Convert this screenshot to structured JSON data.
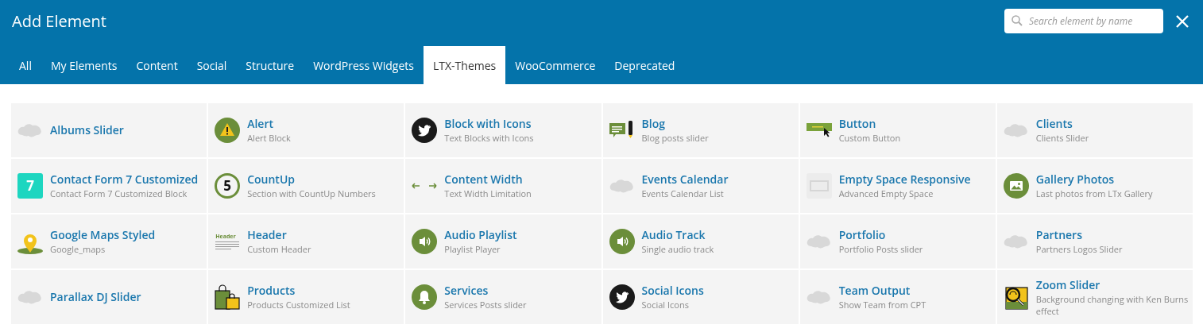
{
  "window": {
    "title": "Add Element"
  },
  "search": {
    "placeholder": "Search element by name"
  },
  "tabs": [
    {
      "label": "All",
      "selected": false
    },
    {
      "label": "My Elements",
      "selected": false
    },
    {
      "label": "Content",
      "selected": false
    },
    {
      "label": "Social",
      "selected": false
    },
    {
      "label": "Structure",
      "selected": false
    },
    {
      "label": "WordPress Widgets",
      "selected": false
    },
    {
      "label": "LTX-Themes",
      "selected": true
    },
    {
      "label": "WooCommerce",
      "selected": false
    },
    {
      "label": "Deprecated",
      "selected": false
    }
  ],
  "elements": [
    {
      "name": "Albums Slider",
      "kind": "cloud"
    },
    {
      "name": "Alert",
      "description": "Alert Block",
      "kind": "alert"
    },
    {
      "name": "Block with Icons",
      "description": "Text Blocks with Icons",
      "kind": "bird"
    },
    {
      "name": "Blog",
      "description": "Blog posts slider",
      "kind": "blog"
    },
    {
      "name": "Button",
      "description": "Custom Button",
      "kind": "button"
    },
    {
      "name": "Clients",
      "description": "Clients Slider",
      "kind": "cloud"
    },
    {
      "name": "Contact Form 7 Customized",
      "description": "Contact Form 7 Customized Block",
      "kind": "square",
      "badge": "7"
    },
    {
      "name": "CountUp",
      "description": "Section with CountUp Numbers",
      "kind": "ring",
      "badge": "5"
    },
    {
      "name": "Content Width",
      "description": "Text Width Limitation",
      "kind": "arrows"
    },
    {
      "name": "Events Calendar",
      "description": "Events Calendar List",
      "kind": "cloud"
    },
    {
      "name": "Empty Space Responsive",
      "description": "Advanced Empty Space",
      "kind": "empty"
    },
    {
      "name": "Gallery Photos",
      "description": "Last photos from LTx Gallery",
      "kind": "gallery"
    },
    {
      "name": "Google Maps Styled",
      "description": "Google_maps",
      "kind": "pin"
    },
    {
      "name": "Header",
      "description": "Custom Header",
      "kind": "header",
      "badge": "Header"
    },
    {
      "name": "Audio Playlist",
      "description": "Playlist Player",
      "kind": "audio"
    },
    {
      "name": "Audio Track",
      "description": "Single audio track",
      "kind": "audio"
    },
    {
      "name": "Portfolio",
      "description": "Portfolio Posts slider",
      "kind": "cloud"
    },
    {
      "name": "Partners",
      "description": "Partners Logos Slider",
      "kind": "cloud"
    },
    {
      "name": "Parallax DJ Slider",
      "kind": "cloud"
    },
    {
      "name": "Products",
      "description": "Products Customized List",
      "kind": "bags"
    },
    {
      "name": "Services",
      "description": "Services Posts slider",
      "kind": "bell"
    },
    {
      "name": "Social Icons",
      "description": "Social Icons",
      "kind": "bird"
    },
    {
      "name": "Team Output",
      "description": "Show Team from CPT",
      "kind": "cloud"
    },
    {
      "name": "Zoom Slider",
      "description": "Background changing with Ken Burns effect",
      "kind": "zoom"
    }
  ]
}
